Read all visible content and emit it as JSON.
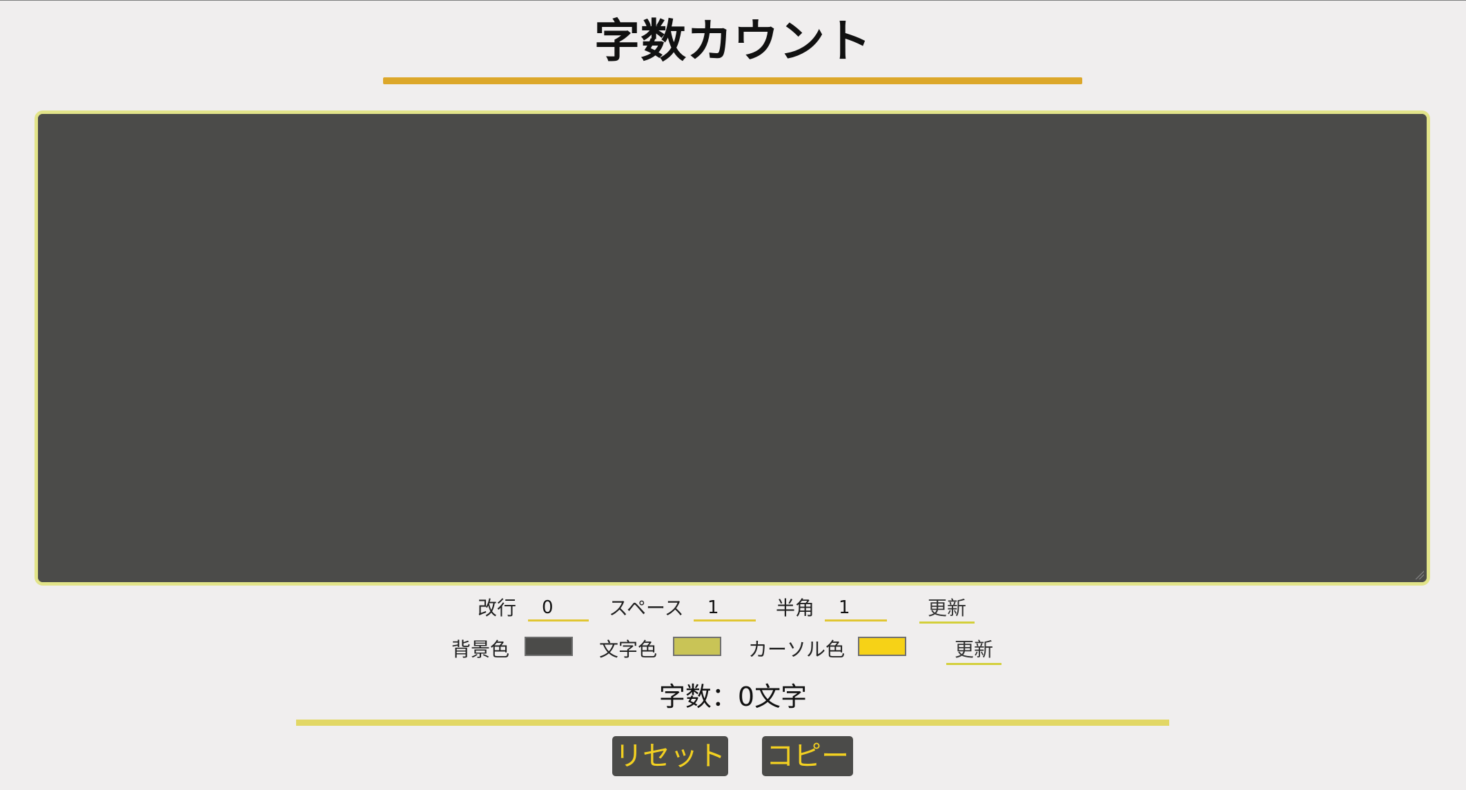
{
  "header": {
    "title": "字数カウント"
  },
  "editor": {
    "text": ""
  },
  "settings_row1": {
    "newline_label": "改行",
    "newline_value": "0",
    "space_label": "スペース",
    "space_value": "1",
    "halfwidth_label": "半角",
    "halfwidth_value": "1",
    "update_label": "更新"
  },
  "settings_row2": {
    "bg_color_label": "背景色",
    "text_color_label": "文字色",
    "cursor_color_label": "カーソル色",
    "update_label": "更新"
  },
  "colors": {
    "background": "#4b4b49",
    "text": "#c9c456",
    "cursor": "#f6d217",
    "accent": "#dca72a"
  },
  "status": {
    "count_text": "字数：0文字"
  },
  "actions": {
    "reset_label": "リセット",
    "copy_label": "コピー"
  }
}
